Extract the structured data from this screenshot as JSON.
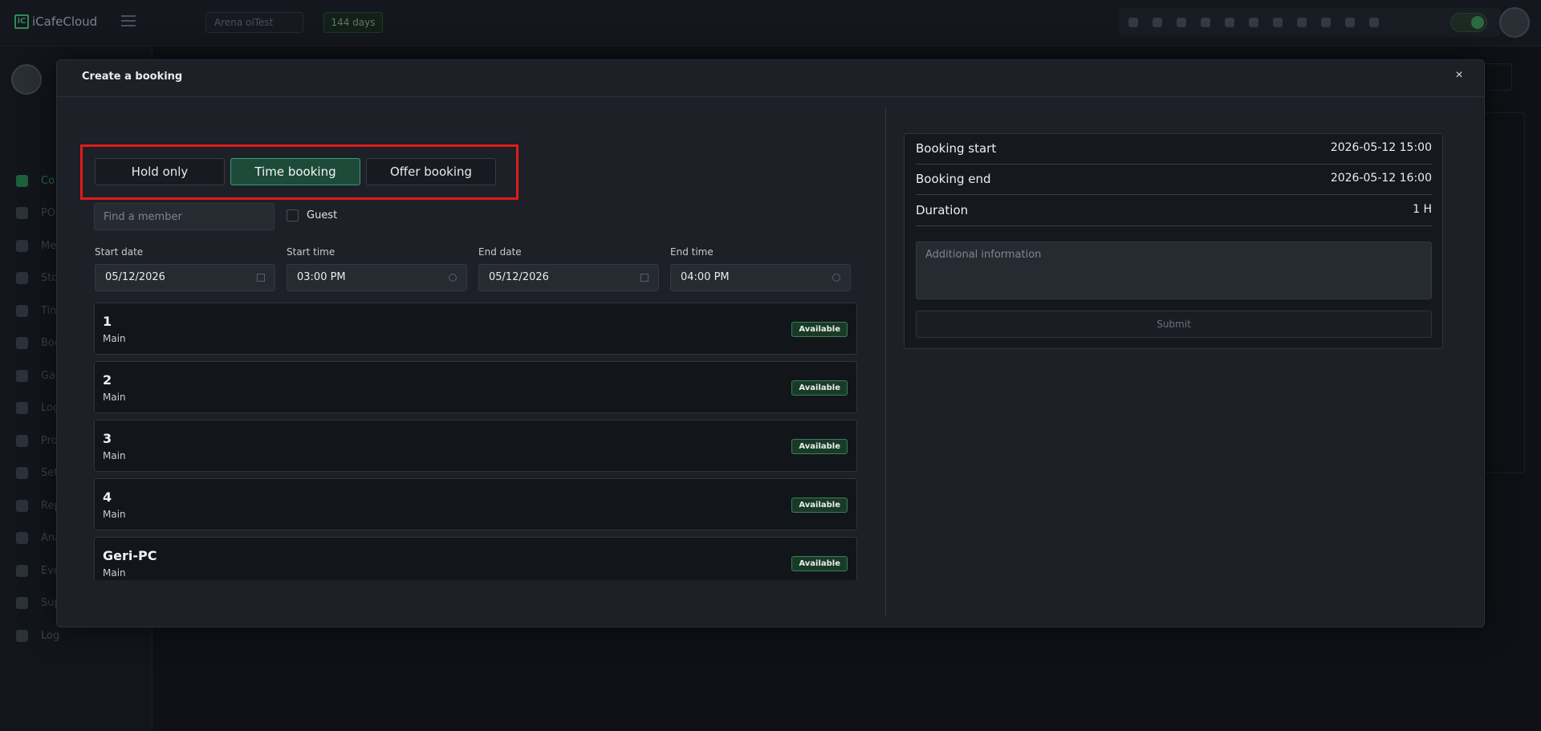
{
  "app": {
    "name": "iCafeCloud",
    "logo_letter": "iC"
  },
  "topbar": {
    "arena_select": "Arena oiTest",
    "days_badge": "144 days",
    "icons": [
      "trophy-chart-icon",
      "trophy-icon",
      "users-icon",
      "rss-icon",
      "facebook-icon",
      "youtube-icon",
      "globe-icon",
      "logo-icon",
      "eye-icon",
      "mail-icon",
      "chat-icon"
    ]
  },
  "sidebar": {
    "items": [
      {
        "label": "Co",
        "icon": "monitor-icon"
      },
      {
        "label": "PO",
        "icon": "pos-icon"
      },
      {
        "label": "Me",
        "icon": "members-icon"
      },
      {
        "label": "Sto",
        "icon": "store-icon"
      },
      {
        "label": "Tin",
        "icon": "timer-icon"
      },
      {
        "label": "Boo",
        "icon": "windows-icon"
      },
      {
        "label": "Ga",
        "icon": "gamepad-icon"
      },
      {
        "label": "Log",
        "icon": "list-icon"
      },
      {
        "label": "Pro",
        "icon": "tag-icon"
      },
      {
        "label": "Set",
        "icon": "gear-icon"
      },
      {
        "label": "Rep",
        "icon": "chart-line-icon"
      },
      {
        "label": "Ana",
        "icon": "chart-area-icon"
      },
      {
        "label": "Eve",
        "icon": "crown-icon"
      },
      {
        "label": "Sup",
        "icon": "phone-icon"
      },
      {
        "label": "Log",
        "icon": "logout-icon"
      }
    ]
  },
  "modal": {
    "title": "Create a booking",
    "close_label": "×",
    "types": [
      "Hold only",
      "Time booking",
      "Offer booking"
    ],
    "active_type": "Time booking",
    "member_placeholder": "Find a member",
    "guest_label": "Guest",
    "fields": {
      "start_date": {
        "label": "Start date",
        "value": "05/12/2026"
      },
      "start_time": {
        "label": "Start time",
        "value": "03:00 PM"
      },
      "end_date": {
        "label": "End date",
        "value": "05/12/2026"
      },
      "end_time": {
        "label": "End time",
        "value": "04:00 PM"
      }
    },
    "pcs": [
      {
        "name": "1",
        "group": "Main",
        "status": "Available"
      },
      {
        "name": "2",
        "group": "Main",
        "status": "Available"
      },
      {
        "name": "3",
        "group": "Main",
        "status": "Available"
      },
      {
        "name": "4",
        "group": "Main",
        "status": "Available"
      },
      {
        "name": "Geri-PC",
        "group": "Main",
        "status": "Available"
      }
    ],
    "summary": {
      "booking_start_label": "Booking start",
      "booking_start_value": "2026-05-12 15:00",
      "booking_end_label": "Booking end",
      "booking_end_value": "2026-05-12 16:00",
      "duration_label": "Duration",
      "duration_value": "1 H",
      "additional_placeholder": "Additional information",
      "submit_label": "Submit"
    }
  },
  "colors": {
    "accent": "#3b9a74",
    "highlight": "#e11b1b",
    "background": "#0f1116",
    "modal": "#1d2027"
  }
}
